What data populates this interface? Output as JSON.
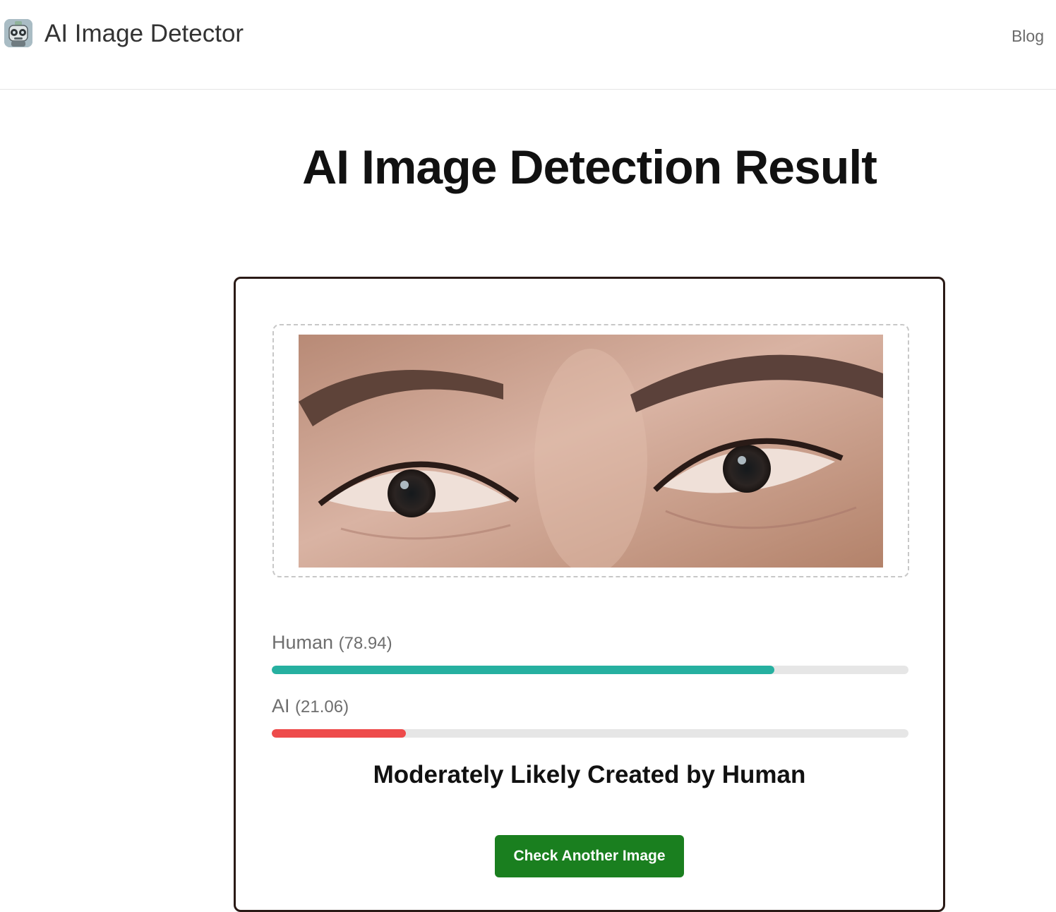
{
  "header": {
    "app_title": "AI Image Detector",
    "logo_icon": "robot-icon",
    "nav_blog": "Blog"
  },
  "main": {
    "title": "AI Image Detection Result"
  },
  "result": {
    "preview_image": "close-up photo of a woman's eyes and eyebrows",
    "scores": [
      {
        "label": "Human",
        "value_text": "(78.94)",
        "value": 78.94,
        "color": "#26b0a0"
      },
      {
        "label": "AI",
        "value_text": "(21.06)",
        "value": 21.06,
        "color": "#ee4b4b"
      }
    ],
    "verdict": "Moderately Likely Created by Human",
    "check_button_label": "Check Another Image"
  },
  "colors": {
    "button": "#1a7f1f",
    "card_border": "#2a1a16",
    "bar_track": "#e6e6e6"
  }
}
